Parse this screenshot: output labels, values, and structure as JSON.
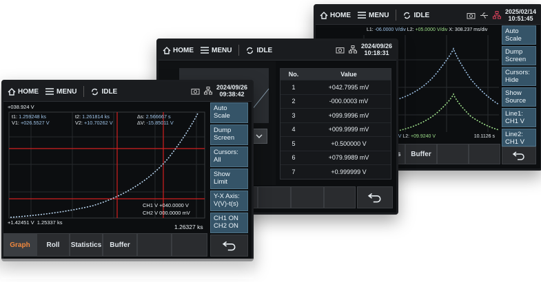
{
  "colors": {
    "accent": "#f0883e",
    "button": "#355468",
    "cursor": "#d22020",
    "trace1": "#9fc4e8",
    "trace2": "#9ee08a"
  },
  "back_screen": {
    "nav": {
      "home": "HOME",
      "menu": "MENU",
      "status": "IDLE"
    },
    "date": "2025/02/14",
    "time": "10:51:45",
    "readout": {
      "l1_label": "L1:",
      "l1_value": "-06.0000 V/div",
      "l2_label": "L2:",
      "l2_value": "+05.0000 V/div",
      "x_label": "X:",
      "x_value": "308.237 ms/div"
    },
    "bottom": {
      "l1_frag": "74 V",
      "l2_label": "L2:",
      "l2_value": "+09.9240 V",
      "time": "10.1126 s"
    },
    "side": [
      "Auto Scale",
      "Dump Screen",
      "Cursors: Hide",
      "Show Source",
      "Line1: CH1 V",
      "Line2: CH1 V"
    ],
    "tabs": [
      "tics",
      "Buffer"
    ]
  },
  "middle_screen": {
    "nav": {
      "home": "HOME",
      "menu": "MENU",
      "status": "IDLE"
    },
    "date": "2024/09/26",
    "time": "10:18:31",
    "table": {
      "headers": [
        "No.",
        "Value"
      ],
      "rows": [
        [
          "1",
          "+042.7995 mV"
        ],
        [
          "2",
          "-000.0003 mV"
        ],
        [
          "3",
          "+099.9996 mV"
        ],
        [
          "4",
          "+009.9999 mV"
        ],
        [
          "5",
          "+0.500000 V"
        ],
        [
          "6",
          "+079.9989 mV"
        ],
        [
          "7",
          "+0.999999 V"
        ]
      ]
    }
  },
  "front_screen": {
    "nav": {
      "home": "HOME",
      "menu": "MENU",
      "status": "IDLE"
    },
    "date": "2024/09/26",
    "time": "09:38:42",
    "top_value": "+038.924 V",
    "cursor_readout": {
      "t1_label": "t1:",
      "t1": "1.259248 ks",
      "v1_label": "V1:",
      "v1": "+026.5527 V",
      "t2_label": "t2:",
      "t2": "1.261814 ks",
      "v2_label": "V2:",
      "v2": "+10.70262 V",
      "ds_label": "Δs:",
      "ds": "2.566667  s",
      "dv_label": "ΔV:",
      "dv": "-15.85011 V"
    },
    "ch_readout": {
      "ch1": "CH1 V +040.0000 V",
      "ch2": "CH2 V 000.0000 mV"
    },
    "bottom_left": "+1.42451 V  1.25337 ks",
    "bottom_right": "1.26327 ks",
    "side": [
      "Auto Scale",
      "Dump Screen",
      "Cursors: All",
      "Show Limit",
      "Y-X Axis: V(V)-t(s)",
      "CH1 ON CH2 ON"
    ],
    "tabs": [
      "Graph",
      "Roll",
      "Statistics",
      "Buffer"
    ],
    "active_tab": "Graph"
  }
}
